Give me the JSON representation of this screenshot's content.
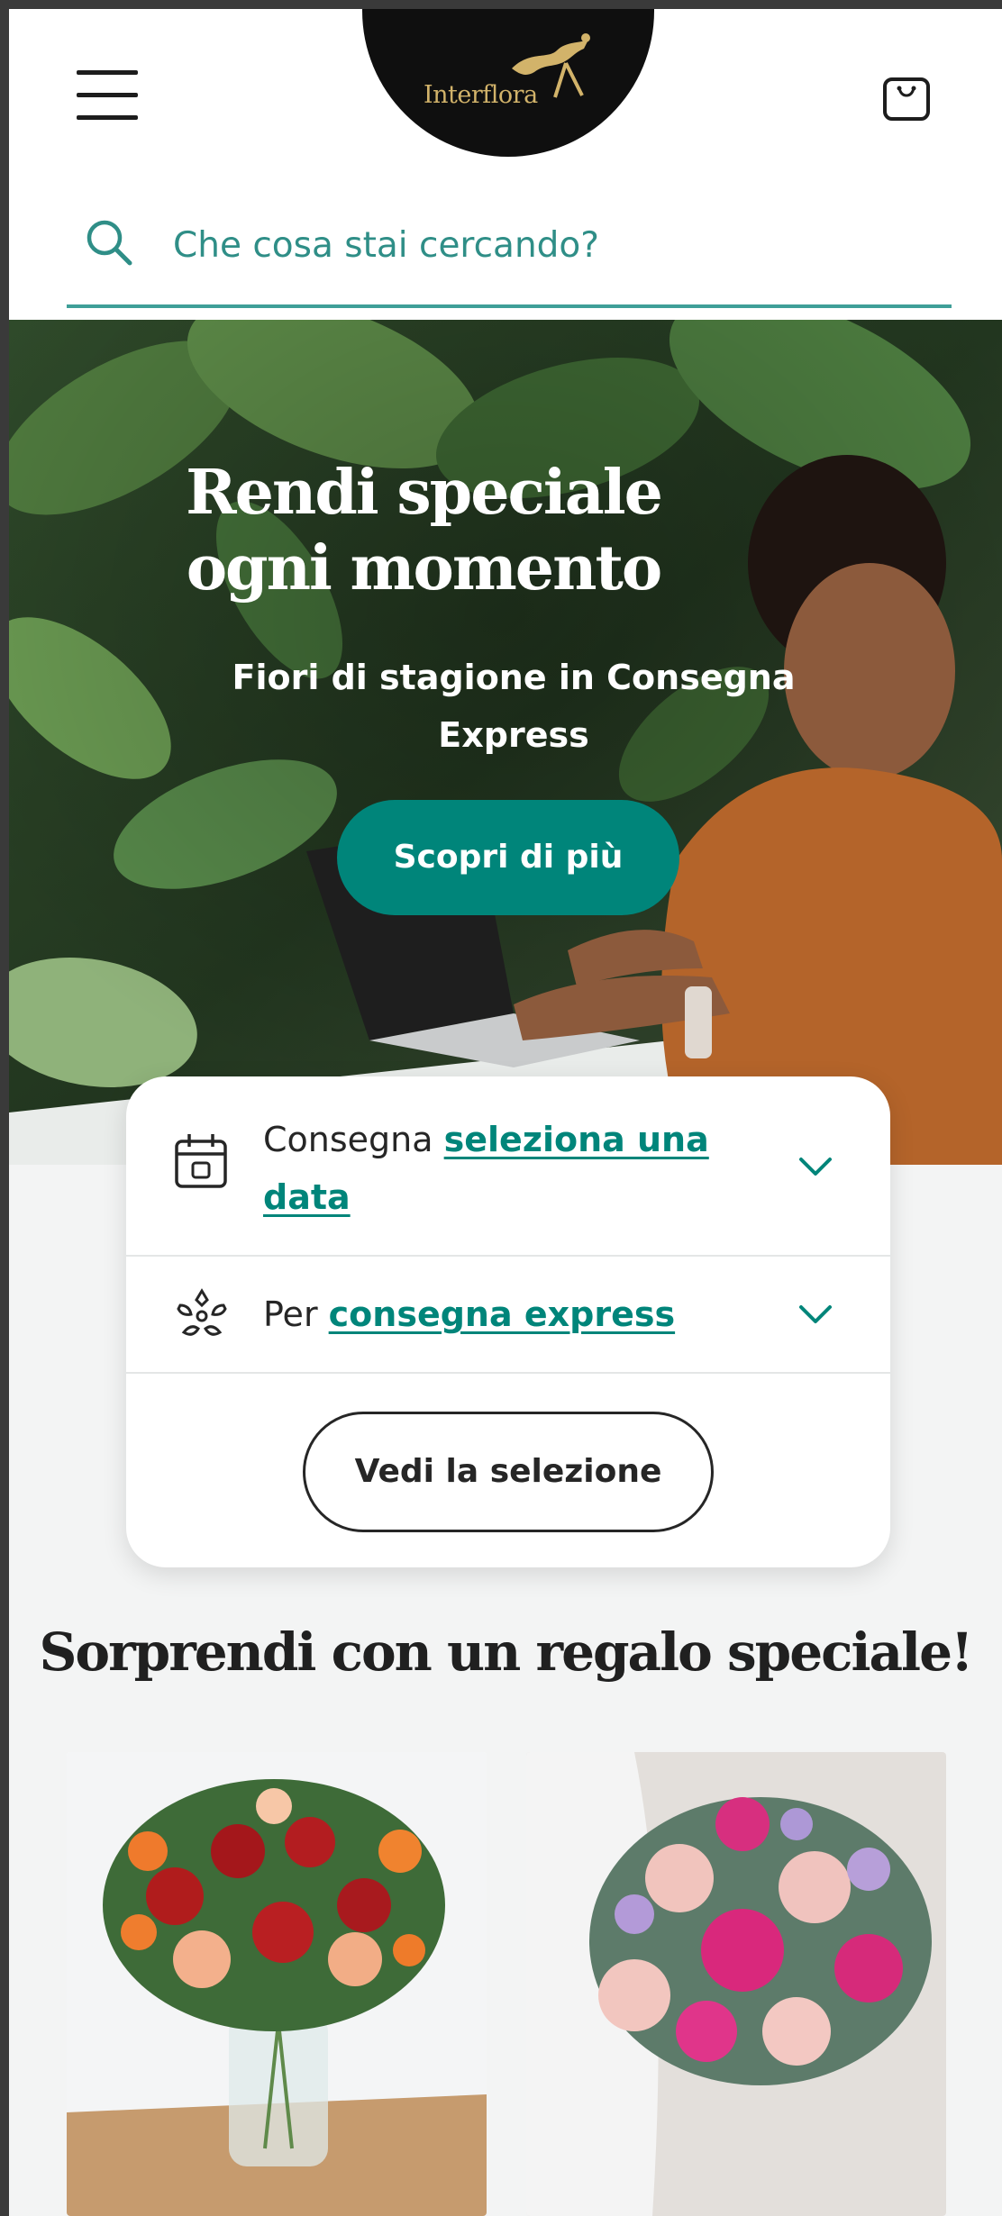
{
  "header": {
    "logo_text": "Interflora",
    "search_placeholder": "Che cosa stai cercando?"
  },
  "hero": {
    "title": "Rendi speciale ogni momento",
    "subtitle": "Fiori di stagione in Consegna Express",
    "cta_label": "Scopri di più"
  },
  "delivery_card": {
    "date_prefix": "Consegna",
    "date_link": "seleziona una data",
    "occasion_prefix": "Per",
    "occasion_link": "consegna express",
    "submit_label": "Vedi la selezione"
  },
  "section": {
    "title": "Sorprendi con un regalo speciale!"
  },
  "colors": {
    "brand_green": "#00857a",
    "search_accent": "#3f9f98",
    "logo_gold": "#d2b36a"
  },
  "icons": [
    "menu-icon",
    "cart-icon",
    "search-icon",
    "calendar-icon",
    "flower-icon",
    "chevron-down-icon"
  ]
}
